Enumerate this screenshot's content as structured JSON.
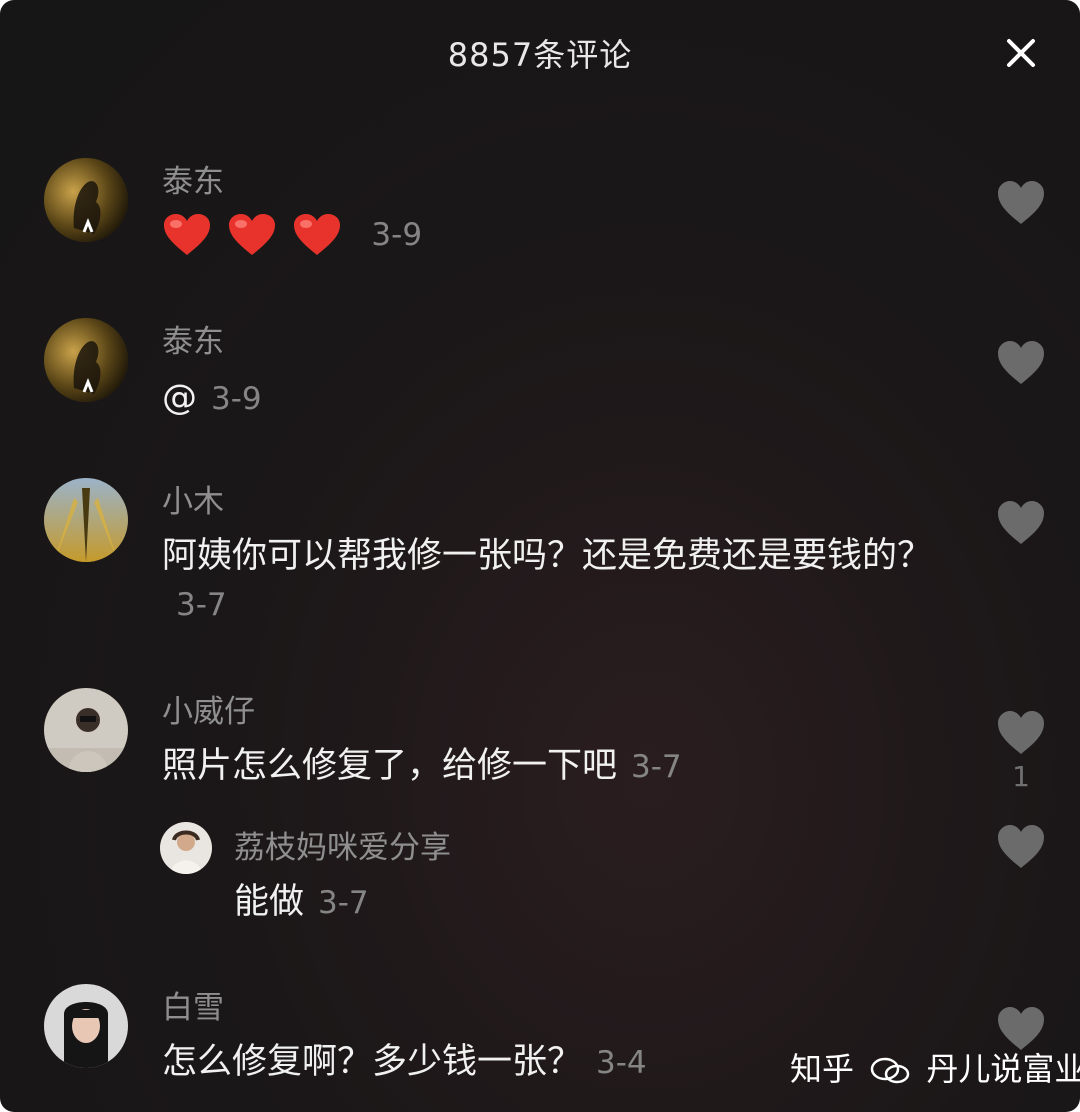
{
  "header": {
    "title": "8857条评论",
    "close_label": "close"
  },
  "comments": [
    {
      "username": "泰东",
      "text": "",
      "date": "3-9",
      "likes": ""
    },
    {
      "username": "泰东",
      "text": "@",
      "date": "3-9",
      "likes": ""
    },
    {
      "username": "小木",
      "text": "阿姨你可以帮我修一张吗？还是免费还是要钱的？",
      "date": "3-7",
      "likes": ""
    },
    {
      "username": "小威仔",
      "text": "照片怎么修复了，给修一下吧",
      "date": "3-7",
      "likes": "1"
    },
    {
      "username": "荔枝妈咪爱分享",
      "text": "能做",
      "date": "3-7",
      "likes": "",
      "is_reply": true
    },
    {
      "username": "白雪",
      "text": "怎么修复啊？多少钱一张？",
      "date": "3-4",
      "likes": ""
    }
  ],
  "emoji_count": 3,
  "icons": {
    "like": "heart-icon",
    "close": "close-icon",
    "emoji": "red-heart-emoji"
  },
  "colors": {
    "background": "#1b1718",
    "heart_grey": "#6b6b6b",
    "emoji_red": "#e8332c"
  },
  "watermark": {
    "text_left": "知乎",
    "text_right": "丹儿说富业"
  }
}
